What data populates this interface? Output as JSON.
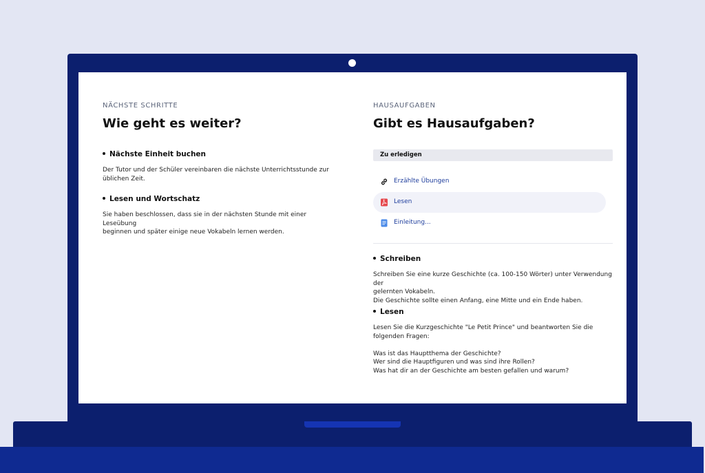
{
  "left": {
    "eyebrow": "NÄCHSTE SCHRITTE",
    "title": "Wie geht es weiter?",
    "items": [
      {
        "heading": "Nächste Einheit buchen",
        "lines": [
          "Der Tutor und der Schüler vereinbaren die nächste Unterrichtsstunde zur",
          "üblichen Zeit."
        ]
      },
      {
        "heading": "Lesen und Wortschatz",
        "lines": [
          "Sie haben beschlossen, dass sie in der nächsten Stunde mit einer Leseübung",
          "beginnen und später einige neue Vokabeln lernen werden."
        ]
      }
    ]
  },
  "right": {
    "eyebrow": "HAUSAUFGABEN",
    "title": "Gibt es Hausaufgaben?",
    "todo_label": "Zu erledigen",
    "resources": [
      {
        "label": "Erzählte Übungen",
        "icon": "link-icon"
      },
      {
        "label": "Lesen",
        "icon": "pdf-icon"
      },
      {
        "label": "Einleitung...",
        "icon": "document-icon"
      }
    ],
    "items": [
      {
        "heading": "Schreiben",
        "lines": [
          "Schreiben Sie eine kurze Geschichte (ca. 100-150 Wörter) unter Verwendung der",
          "gelernten Vokabeln.",
          "Die Geschichte sollte einen Anfang, eine Mitte und ein Ende haben."
        ]
      },
      {
        "heading": "Lesen",
        "lines": [
          "Lesen Sie die Kurzgeschichte \"Le Petit Prince\" und beantworten Sie die",
          "folgenden Fragen:",
          "",
          "Was ist das Hauptthema der Geschichte?",
          "Wer sind die Hauptfiguren und was sind ihre Rollen?",
          "Was hat dir an der Geschichte am besten gefallen und warum?"
        ]
      }
    ]
  },
  "colors": {
    "laptop": "#0c1f6e",
    "base_accent": "#1534b3",
    "background": "#e3e6f3",
    "link": "#1e3d9c",
    "pdf": "#e5484d",
    "doc": "#4a8ae8"
  }
}
